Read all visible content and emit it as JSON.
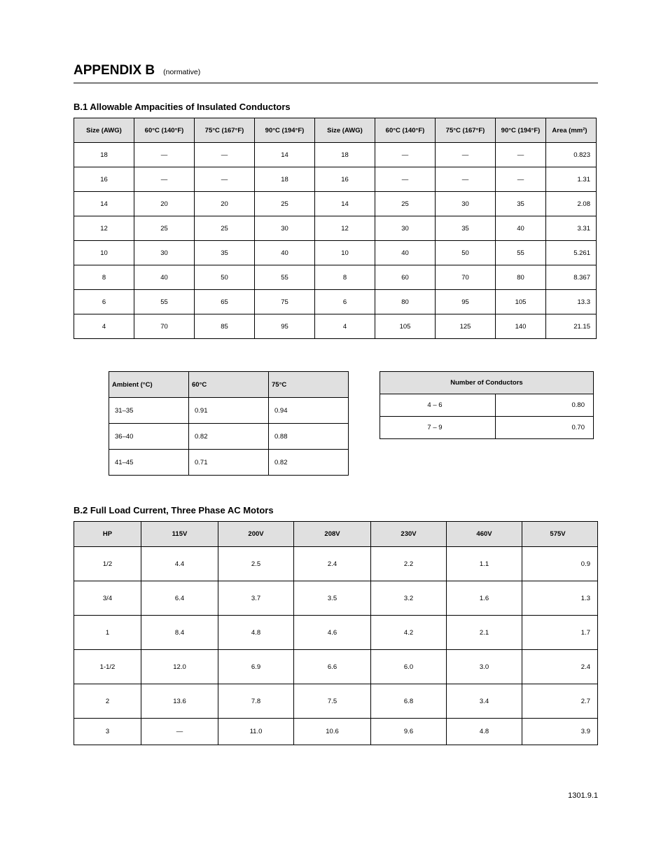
{
  "header": {
    "title": "APPENDIX B",
    "subtitle": "(normative)"
  },
  "section1": {
    "title": "B.1 Allowable Ampacities of Insulated Conductors",
    "table": {
      "headers": [
        "Size (AWG)",
        "60°C (140°F)",
        "75°C (167°F)",
        "90°C (194°F)",
        "Size (AWG)",
        "60°C (140°F)",
        "75°C (167°F)",
        "90°C (194°F)",
        "Area (mm²)"
      ],
      "rows": [
        [
          "18",
          "—",
          "—",
          "14",
          "18",
          "—",
          "—",
          "—",
          "0.823"
        ],
        [
          "16",
          "—",
          "—",
          "18",
          "16",
          "—",
          "—",
          "—",
          "1.31"
        ],
        [
          "14",
          "20",
          "20",
          "25",
          "14",
          "25",
          "30",
          "35",
          "2.08"
        ],
        [
          "12",
          "25",
          "25",
          "30",
          "12",
          "30",
          "35",
          "40",
          "3.31"
        ],
        [
          "10",
          "30",
          "35",
          "40",
          "10",
          "40",
          "50",
          "55",
          "5.261"
        ],
        [
          "8",
          "40",
          "50",
          "55",
          "8",
          "60",
          "70",
          "80",
          "8.367"
        ],
        [
          "6",
          "55",
          "65",
          "75",
          "6",
          "80",
          "95",
          "105",
          "13.3"
        ],
        [
          "4",
          "70",
          "85",
          "95",
          "4",
          "105",
          "125",
          "140",
          "21.15"
        ]
      ]
    }
  },
  "section2": {
    "tempTable": {
      "headers": [
        "Ambient (°C)",
        "60°C",
        "75°C"
      ],
      "rows": [
        [
          "31–35",
          "0.91",
          "0.94"
        ],
        [
          "36–40",
          "0.82",
          "0.88"
        ],
        [
          "41–45",
          "0.71",
          "0.82"
        ]
      ]
    },
    "countTable": {
      "header": "Number of Conductors",
      "rows": [
        [
          "4 – 6",
          "0.80"
        ],
        [
          "7 – 9",
          "0.70"
        ]
      ]
    }
  },
  "section3": {
    "title": "B.2 Full Load Current, Three Phase AC Motors",
    "table": {
      "headers": [
        "HP",
        "115V",
        "200V",
        "208V",
        "230V",
        "460V",
        "575V"
      ],
      "rows": [
        [
          "1/2",
          "4.4",
          "2.5",
          "2.4",
          "2.2",
          "1.1",
          "0.9"
        ],
        [
          "3/4",
          "6.4",
          "3.7",
          "3.5",
          "3.2",
          "1.6",
          "1.3"
        ],
        [
          "1",
          "8.4",
          "4.8",
          "4.6",
          "4.2",
          "2.1",
          "1.7"
        ],
        [
          "1-1/2",
          "12.0",
          "6.9",
          "6.6",
          "6.0",
          "3.0",
          "2.4"
        ],
        [
          "2",
          "13.6",
          "7.8",
          "7.5",
          "6.8",
          "3.4",
          "2.7"
        ],
        [
          "3",
          "—",
          "11.0",
          "10.6",
          "9.6",
          "4.8",
          "3.9"
        ]
      ]
    }
  },
  "footer": "1301.9.1"
}
